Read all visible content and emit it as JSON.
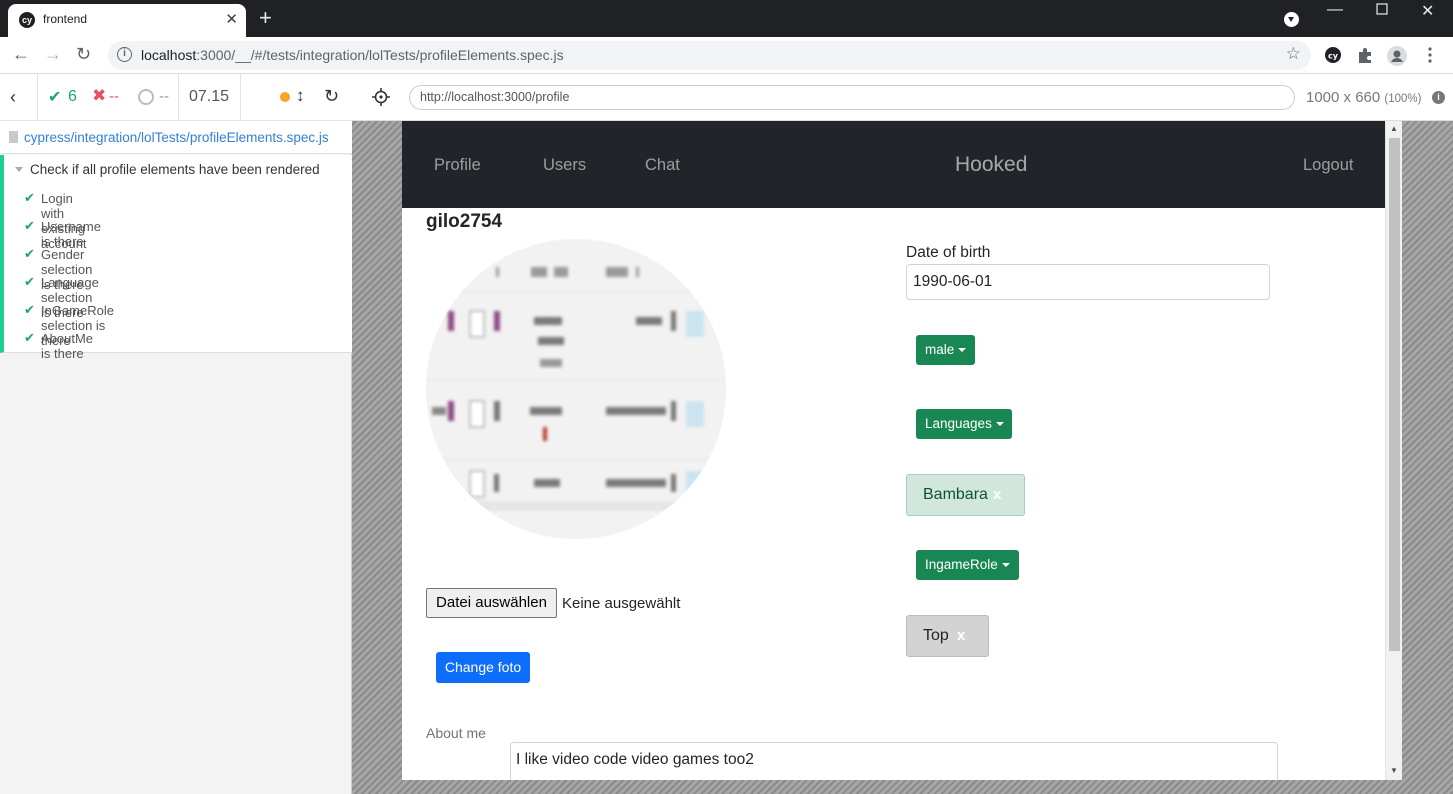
{
  "browser": {
    "tab_title": "frontend",
    "favicon_text": "cy",
    "url_host": "localhost",
    "url_rest": ":3000/__/#/tests/integration/lolTests/profileElements.spec.js"
  },
  "reporter": {
    "passed_count": "6",
    "failed_count": "--",
    "pending_count": "--",
    "duration": "07.15",
    "spec_path": "cypress/integration/lolTests/profileElements.spec.js",
    "suite_title": "Check if all profile elements have been rendered",
    "tests": [
      {
        "label": "Login with existing account"
      },
      {
        "label": "Username is there"
      },
      {
        "label": "Gender selection is there"
      },
      {
        "label": "Language selection is there"
      },
      {
        "label": "InGameRole selection is there"
      },
      {
        "label": "AboutMe is there"
      }
    ]
  },
  "runner": {
    "aut_url": "http://localhost:3000/profile",
    "viewport": "1000 x 660",
    "zoom": "(100%)"
  },
  "app": {
    "nav": {
      "profile": "Profile",
      "users": "Users",
      "chat": "Chat",
      "brand": "Hooked",
      "logout": "Logout"
    },
    "username": "gilo2754",
    "file_button": "Datei auswählen",
    "file_status": "Keine ausgewählt",
    "change_foto": "Change foto",
    "dob_label": "Date of birth",
    "dob_value": "1990-06-01",
    "gender_button": "male",
    "languages_button": "Languages",
    "language_chip": "Bambara",
    "ingamerole_button": "IngameRole",
    "role_chip": "Top",
    "chip_remove": "x",
    "about_label": "About me",
    "about_value": "I like video code video games too2"
  },
  "colors": {
    "pass": "#1ba27a",
    "fail": "#e94f5f",
    "pending_dot": "#f8a529",
    "link": "#3380d8",
    "nav_bg": "#212529",
    "primary": "#0d6efd",
    "success": "#198754"
  },
  "icons": [
    "back-icon",
    "forward-icon",
    "reload-icon",
    "info-icon",
    "star-icon",
    "extension-icon",
    "account-icon",
    "menu-icon",
    "file-icon",
    "check-icon",
    "cross-icon",
    "spinner-icon",
    "crosshair-icon",
    "info-circle-icon"
  ]
}
